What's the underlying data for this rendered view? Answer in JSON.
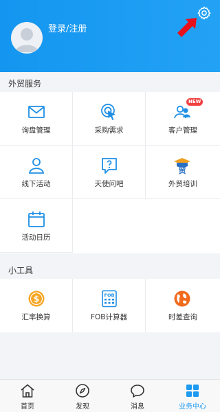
{
  "header": {
    "login_label": "登录/注册",
    "accent": "#1496f0"
  },
  "foreign_trade": {
    "title": "外贸服务",
    "items": [
      {
        "label": "询盘管理",
        "icon": "mail-icon"
      },
      {
        "label": "采购需求",
        "icon": "target-click-icon"
      },
      {
        "label": "客户管理",
        "icon": "customers-icon",
        "badge": "NEW"
      },
      {
        "label": "线下活动",
        "icon": "person-icon"
      },
      {
        "label": "天使问吧",
        "icon": "question-bubble-icon"
      },
      {
        "label": "外贸培训",
        "icon": "graduation-cap-icon"
      },
      {
        "label": "活动日历",
        "icon": "calendar-icon"
      }
    ]
  },
  "tools": {
    "title": "小工具",
    "items": [
      {
        "label": "汇率换算",
        "icon": "dollar-coin-icon"
      },
      {
        "label": "FOB计算器",
        "icon": "fob-calculator-icon"
      },
      {
        "label": "时差查询",
        "icon": "globe-icon"
      }
    ]
  },
  "tabbar": {
    "items": [
      {
        "label": "首页",
        "icon": "home-icon"
      },
      {
        "label": "发现",
        "icon": "compass-icon"
      },
      {
        "label": "消息",
        "icon": "chat-icon"
      },
      {
        "label": "业务中心",
        "icon": "grid-icon",
        "active": true
      }
    ],
    "active_color": "#1e9af0"
  }
}
